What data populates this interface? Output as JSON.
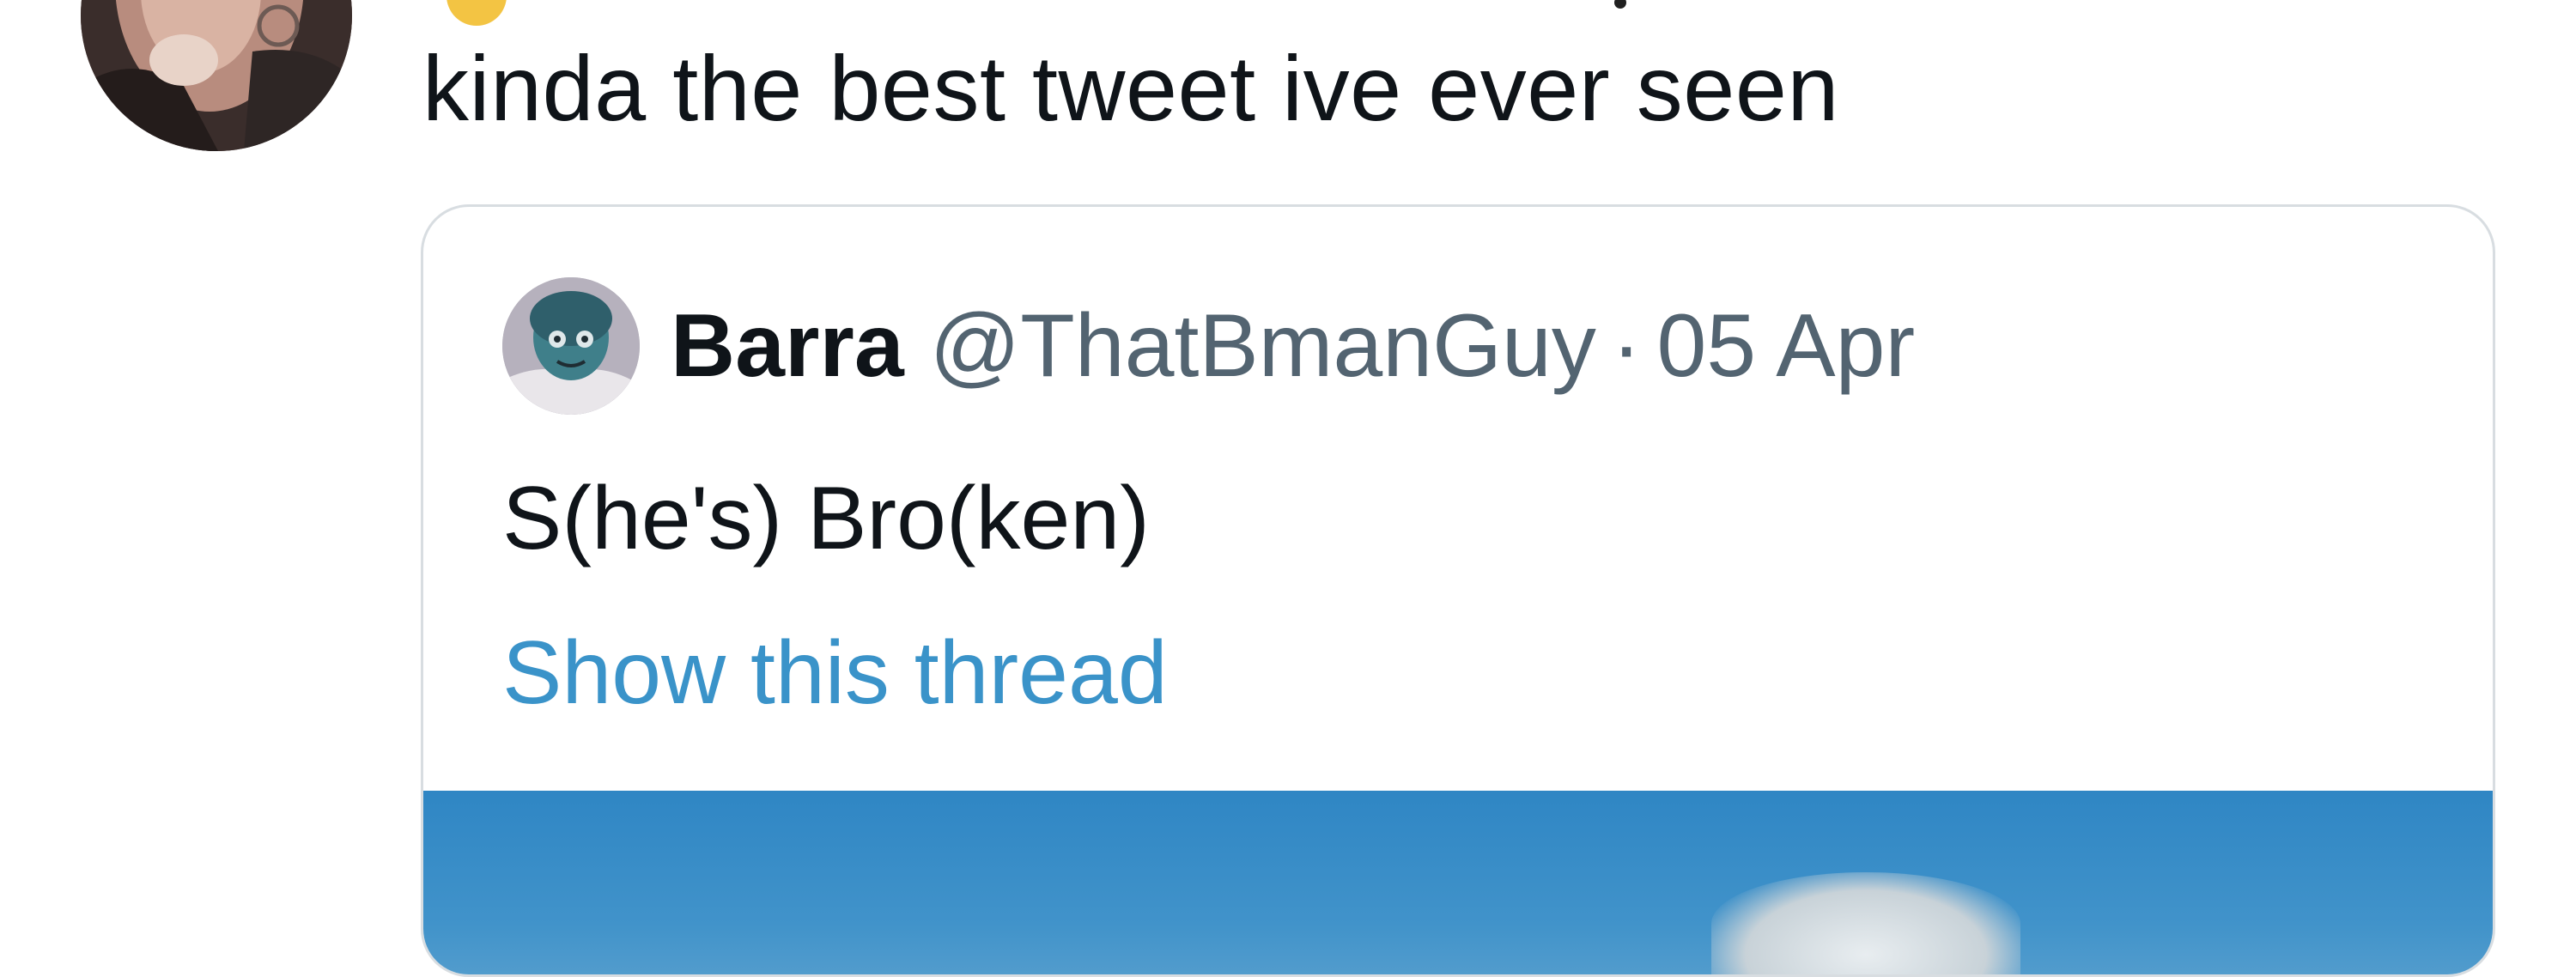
{
  "tweet": {
    "text": "kinda the best tweet ive ever seen"
  },
  "quote": {
    "name": "Barra",
    "handle": "@ThatBmanGuy",
    "separator": "·",
    "date": "05 Apr",
    "text": "S(he's) Bro(ken)",
    "show_thread_label": "Show this thread"
  },
  "icons": {
    "author_avatar": "user-avatar-icon",
    "quote_avatar": "user-avatar-icon"
  },
  "colors": {
    "text_primary": "#0f1419",
    "text_secondary": "#536471",
    "link": "#3a93c9",
    "card_border": "#d8dde1",
    "media_sky": "#3c8fc9"
  }
}
